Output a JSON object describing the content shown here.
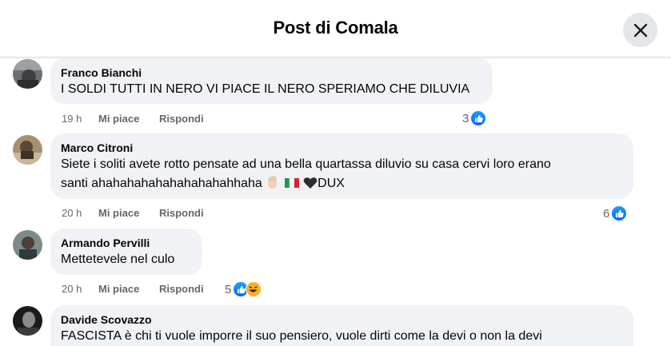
{
  "header": {
    "title": "Post di Comala"
  },
  "comments": [
    {
      "author": "Franco Bianchi",
      "text": "I SOLDI TUTTI IN NERO VI PIACE IL NERO SPERIAMO CHE DILUVIA",
      "time": "19 h",
      "like_label": "Mi piace",
      "reply_label": "Rispondi",
      "reactions": "3"
    },
    {
      "author": "Marco Citroni",
      "text_line1": "Siete i soliti avete rotto pensate ad una bella quartassa diluvio su casa cervi loro erano",
      "text_line2": "santi ahahahahahahahahahahhaha",
      "text_tail": "DUX",
      "time": "20 h",
      "like_label": "Mi piace",
      "reply_label": "Rispondi",
      "reactions": "6"
    },
    {
      "author": "Armando Pervilli",
      "text": "Mettetevele nel culo",
      "time": "20 h",
      "like_label": "Mi piace",
      "reply_label": "Rispondi",
      "reactions": "5"
    },
    {
      "author": "Davide Scovazzo",
      "text": "FASCISTA è chi ti vuole imporre il suo pensiero, vuole dirti come la devi o non la devi"
    }
  ],
  "icons": {
    "close": "close-icon",
    "like": "like-reaction-icon",
    "haha": "haha-reaction-icon"
  },
  "colors": {
    "accent": "#0866ff",
    "bubble": "#f0f2f5",
    "meta": "#65676b"
  }
}
